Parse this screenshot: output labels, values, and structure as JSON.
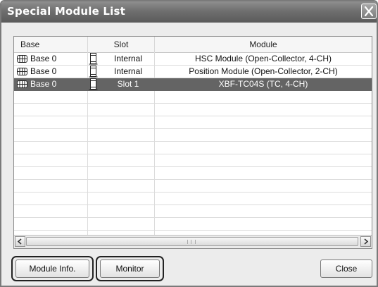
{
  "window": {
    "title": "Special Module List"
  },
  "list": {
    "headers": {
      "base": "Base",
      "slot": "Slot",
      "module": "Module"
    },
    "rows": [
      {
        "base": "Base 0",
        "slot": "Internal",
        "module": "HSC Module (Open-Collector, 4-CH)",
        "selected": false,
        "base_icon": "base-icon",
        "slot_icon": "slot-icon"
      },
      {
        "base": "Base 0",
        "slot": "Internal",
        "module": "Position Module (Open-Collector, 2-CH)",
        "selected": false,
        "base_icon": "base-icon",
        "slot_icon": "slot-icon"
      },
      {
        "base": "Base 0",
        "slot": "Slot 1",
        "module": "XBF-TC04S (TC, 4-CH)",
        "selected": true,
        "base_icon": "base-icon",
        "slot_icon": "slot-icon"
      }
    ]
  },
  "buttons": {
    "module_info": "Module Info.",
    "monitor": "Monitor",
    "close": "Close"
  },
  "colors": {
    "selection": "#646464",
    "titlebar": "#6f6f6f",
    "dialog_bg": "#ececec"
  }
}
